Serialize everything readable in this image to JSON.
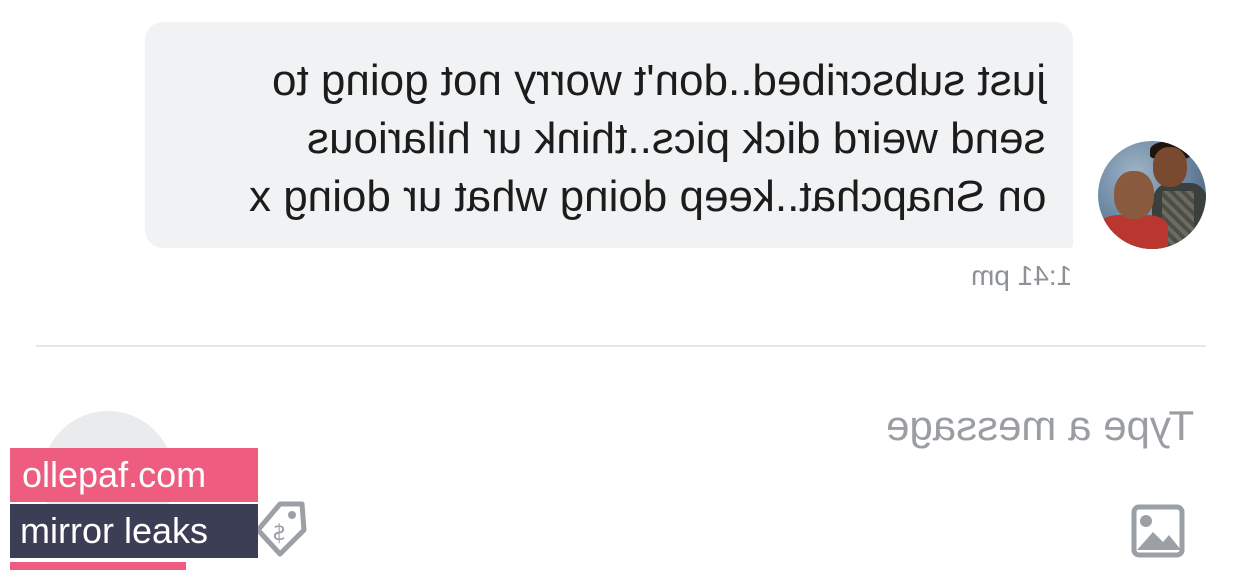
{
  "message": {
    "lines": [
      "just subscribed..don't worry not going to",
      "send weird dick pics..think ur hilarious",
      "on Snapchat..keep doing what ur doing x"
    ],
    "time": "1:41 pm"
  },
  "composer": {
    "placeholder": "Type a message"
  },
  "icons": {
    "image": "image-icon",
    "tip": "dollar-tag-icon",
    "avatar": "avatar"
  },
  "watermark": {
    "site": "ollepaf.com",
    "label": "mirror leaks"
  },
  "colors": {
    "bubble": "#f0f2f3",
    "watermark_pink": "#ee5c7f",
    "watermark_dark": "#3c3e55",
    "icon_gray": "#9aa0a6"
  }
}
